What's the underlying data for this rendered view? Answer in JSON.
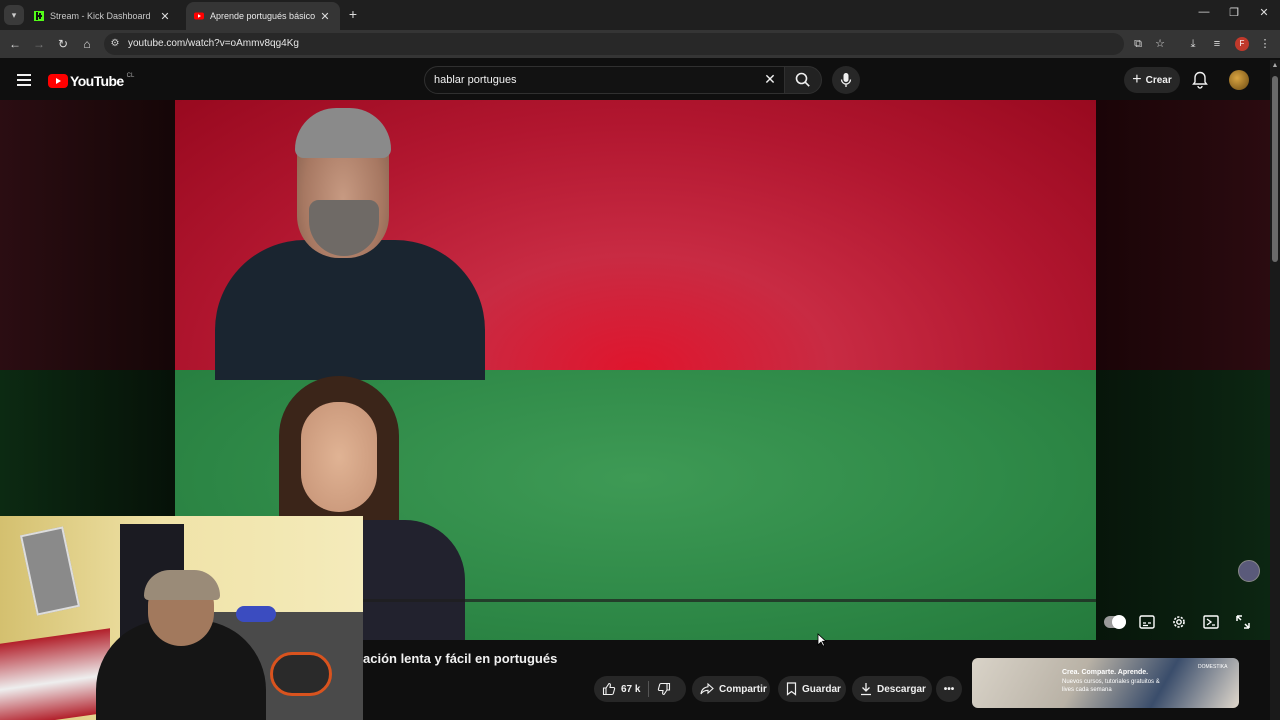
{
  "browser": {
    "tabs": [
      {
        "label": "Stream - Kick Dashboard",
        "active": false
      },
      {
        "label": "Aprende portugués básico para",
        "active": true
      }
    ],
    "url": "youtube.com/watch?v=oAmmv8qg4Kg",
    "profile_initial": "F"
  },
  "youtube": {
    "logo_text": "YouTube",
    "country_code": "CL",
    "search_value": "hablar portugues",
    "create_label": "Crear"
  },
  "video": {
    "title": "ación lenta y fácil en portugués",
    "likes": "67 k",
    "share_label": "Compartir",
    "save_label": "Guardar",
    "download_label": "Descargar"
  },
  "ad": {
    "headline": "Crea. Comparte. Aprende.",
    "subtext": "Nuevos cursos, tutoriales gratuitos & lives cada semana",
    "brand": "DOMESTIKA"
  },
  "colors": {
    "brand_red": "#ff0000",
    "video_top": "#c82b43",
    "video_bottom": "#2f8a48"
  }
}
